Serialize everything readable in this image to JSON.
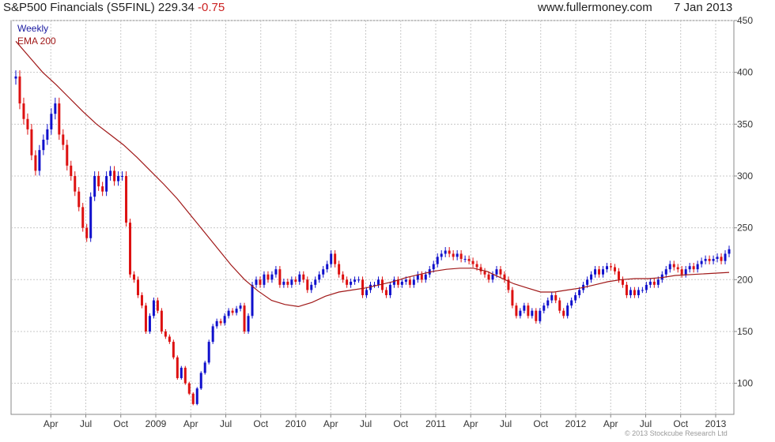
{
  "header": {
    "title": "S&P500 Financials (S5FINL)",
    "price": "229.34",
    "change": "-0.75",
    "site": "www.fullermoney.com",
    "date": "7 Jan 2013"
  },
  "footer": {
    "copyright": "© 2013 Stockcube Research Ltd"
  },
  "colors": {
    "up": "#1010cc",
    "down": "#dd1111",
    "ema": "#a01818",
    "grid": "#c8c8c8",
    "legend_weekly": "#1a1aa0",
    "legend_ema": "#a01818"
  },
  "chart_data": {
    "type": "candlestick",
    "period": "Weekly",
    "legend": [
      "Weekly",
      "EMA 200"
    ],
    "ylim": [
      70,
      450
    ],
    "y_ticks": [
      100,
      150,
      200,
      250,
      300,
      350,
      400,
      450
    ],
    "x_ticks": [
      "Apr",
      "Jul",
      "Oct",
      "2009",
      "Apr",
      "Jul",
      "Oct",
      "2010",
      "Apr",
      "Jul",
      "Oct",
      "2011",
      "Apr",
      "Jul",
      "Oct",
      "2012",
      "Apr",
      "Jul",
      "Oct",
      "2013"
    ],
    "x_tick_weeks": [
      13,
      26,
      39,
      52,
      65,
      78,
      91,
      104,
      117,
      130,
      143,
      156,
      169,
      182,
      195,
      208,
      221,
      234,
      247,
      260
    ],
    "weeks_total": 265,
    "weekly_close": [
      396,
      370,
      355,
      345,
      320,
      305,
      325,
      335,
      345,
      360,
      370,
      340,
      330,
      310,
      300,
      285,
      270,
      250,
      240,
      280,
      300,
      290,
      285,
      300,
      305,
      295,
      300,
      300,
      255,
      205,
      200,
      185,
      175,
      150,
      165,
      180,
      170,
      150,
      145,
      140,
      125,
      105,
      115,
      100,
      90,
      80,
      95,
      110,
      120,
      140,
      155,
      160,
      158,
      165,
      170,
      168,
      172,
      175,
      150,
      165,
      195,
      200,
      195,
      205,
      200,
      205,
      210,
      195,
      198,
      195,
      200,
      198,
      205,
      200,
      190,
      195,
      200,
      205,
      210,
      215,
      225,
      215,
      205,
      200,
      195,
      198,
      200,
      200,
      185,
      190,
      195,
      195,
      200,
      190,
      185,
      195,
      200,
      195,
      198,
      200,
      195,
      200,
      205,
      200,
      205,
      210,
      215,
      222,
      225,
      228,
      225,
      222,
      225,
      220,
      220,
      218,
      215,
      212,
      208,
      205,
      200,
      205,
      210,
      205,
      200,
      190,
      175,
      165,
      170,
      175,
      165,
      170,
      160,
      170,
      175,
      180,
      185,
      180,
      170,
      165,
      175,
      180,
      185,
      190,
      195,
      200,
      205,
      210,
      205,
      210,
      213,
      212,
      208,
      200,
      195,
      185,
      190,
      185,
      190,
      190,
      195,
      198,
      195,
      200,
      205,
      210,
      215,
      212,
      210,
      205,
      210,
      213,
      210,
      215,
      218,
      220,
      218,
      220,
      222,
      218,
      225,
      229.34
    ],
    "ema200": [
      430,
      415,
      400,
      388,
      375,
      362,
      350,
      340,
      330,
      318,
      305,
      292,
      278,
      262,
      246,
      230,
      214,
      200,
      189,
      180,
      176,
      174,
      178,
      184,
      188,
      190,
      192,
      195,
      198,
      202,
      205,
      208,
      210,
      211,
      211,
      208,
      202,
      196,
      192,
      188,
      188,
      190,
      192,
      195,
      198,
      200,
      201,
      201,
      202,
      204,
      207
    ],
    "ema200_weeks": [
      0,
      5,
      10,
      15,
      20,
      25,
      30,
      35,
      40,
      45,
      50,
      55,
      60,
      65,
      70,
      75,
      80,
      85,
      90,
      95,
      100,
      105,
      110,
      115,
      120,
      125,
      130,
      135,
      140,
      145,
      150,
      155,
      160,
      165,
      170,
      175,
      180,
      185,
      190,
      195,
      200,
      205,
      210,
      215,
      220,
      225,
      230,
      235,
      240,
      245,
      265
    ]
  }
}
